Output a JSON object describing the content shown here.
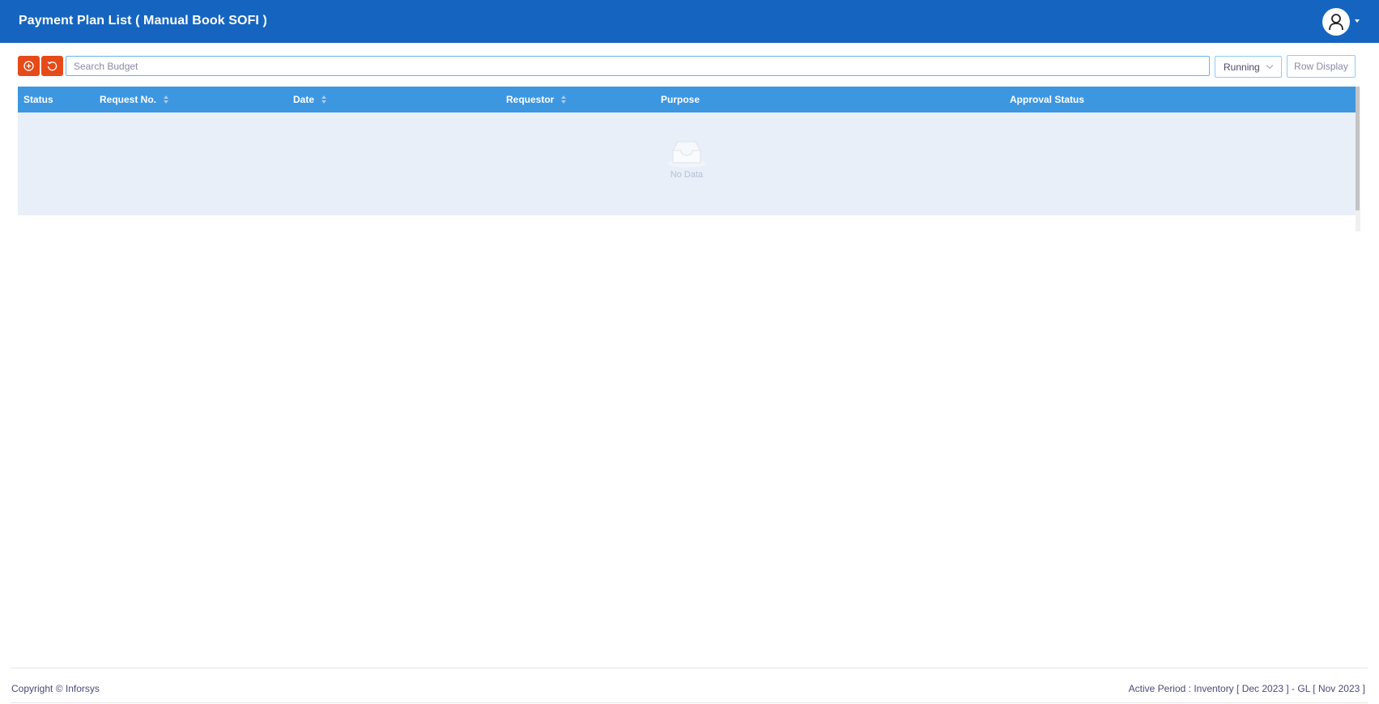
{
  "header": {
    "title": "Payment Plan List ( Manual Book SOFI )",
    "avatar_icon": "user-icon",
    "caret_icon": "caret-down-icon",
    "background_color": "#1565c0"
  },
  "toolbar": {
    "add_icon": "add-circle-icon",
    "reset_icon": "refresh-icon",
    "button_color": "#e64a19",
    "search": {
      "placeholder": "Search Budget",
      "value": ""
    },
    "status_filter": {
      "selected": "Running",
      "icon": "chevron-down-icon"
    },
    "row_display_label": "Row Display"
  },
  "table": {
    "header_color": "#3d96e0",
    "columns": [
      {
        "label": "Status",
        "sortable": false
      },
      {
        "label": "Request No.",
        "sortable": true
      },
      {
        "label": "Date",
        "sortable": true
      },
      {
        "label": "Requestor",
        "sortable": true
      },
      {
        "label": "Purpose",
        "sortable": false
      },
      {
        "label": "Approval Status",
        "sortable": false
      }
    ],
    "rows": [],
    "empty_text": "No Data",
    "empty_icon": "empty-inbox-icon"
  },
  "footer": {
    "copyright": "Copyright © Inforsys",
    "active_period": "Active Period : Inventory [ Dec 2023 ] - GL [ Nov 2023 ]"
  }
}
